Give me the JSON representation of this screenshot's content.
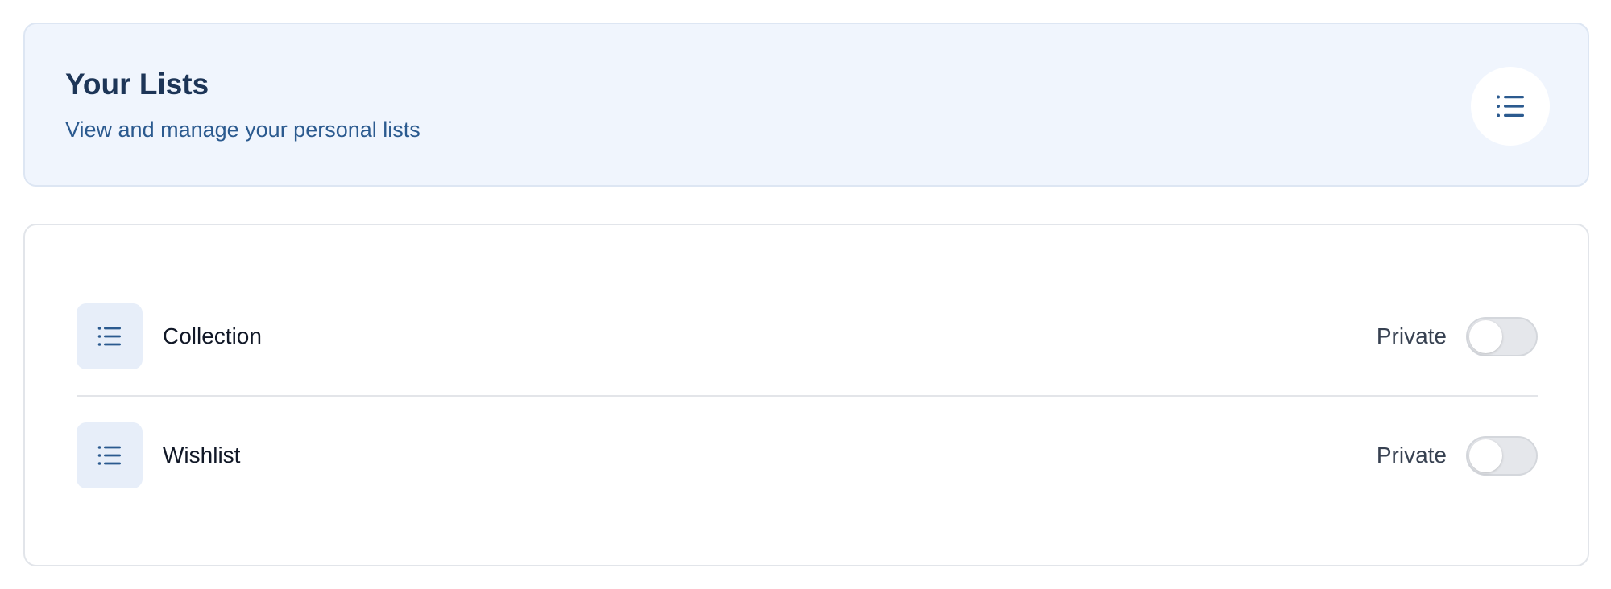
{
  "header": {
    "title": "Your Lists",
    "subtitle": "View and manage your personal lists",
    "icon": "list-icon"
  },
  "lists": [
    {
      "name": "Collection",
      "visibility": "Private",
      "is_public": false,
      "icon": "list-icon"
    },
    {
      "name": "Wishlist",
      "visibility": "Private",
      "is_public": false,
      "icon": "list-icon"
    }
  ],
  "colors": {
    "accent": "#2b5a8f",
    "header_bg": "#f0f5fd",
    "icon_bg": "#e7eef9",
    "toggle_off": "#e5e7eb"
  }
}
